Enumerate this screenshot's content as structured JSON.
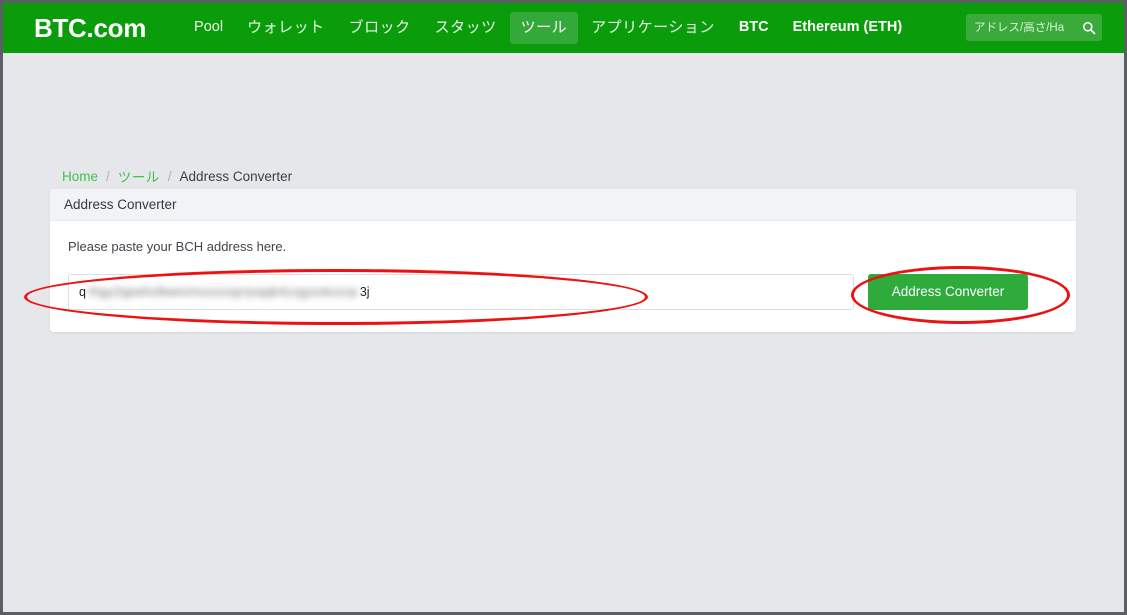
{
  "navbar": {
    "brand": "BTC.com",
    "items": [
      {
        "label": "Pool",
        "active": false,
        "style": "en"
      },
      {
        "label": "ウォレット",
        "active": false,
        "style": "jp"
      },
      {
        "label": "ブロック",
        "active": false,
        "style": "jp"
      },
      {
        "label": "スタッツ",
        "active": false,
        "style": "jp"
      },
      {
        "label": "ツール",
        "active": true,
        "style": "jp"
      },
      {
        "label": "アプリケーション",
        "active": false,
        "style": "jp"
      },
      {
        "label": "BTC",
        "active": false,
        "style": "bold"
      },
      {
        "label": "Ethereum (ETH)",
        "active": false,
        "style": "bold"
      }
    ],
    "search": {
      "placeholder": "アドレス/高さ/Ha",
      "value": "",
      "icon": "search-icon"
    },
    "background_color": "#0b9c0b",
    "active_color": "#34a93a"
  },
  "breadcrumb": {
    "home": "Home",
    "section": "ツール",
    "current": "Address Converter",
    "separator": "/"
  },
  "card": {
    "title": "Address Converter",
    "help_text": "Please paste your BCH address here.",
    "input": {
      "value_prefix": "q",
      "value_redacted": "rhgy2qpwhz8wexmvzzzzqzrjvqqk4zzgyxskzzzp",
      "value_suffix": "3j",
      "placeholder": "",
      "redacted": true
    },
    "submit_label": "Address Converter",
    "submit_color": "#2fab3c"
  },
  "annotations": [
    {
      "name": "input-highlight",
      "shape": "ellipse",
      "color": "#ee1111"
    },
    {
      "name": "button-highlight",
      "shape": "ellipse",
      "color": "#ee1111"
    }
  ],
  "page": {
    "background_color": "#e6e7eb",
    "card_background": "#ffffff"
  }
}
